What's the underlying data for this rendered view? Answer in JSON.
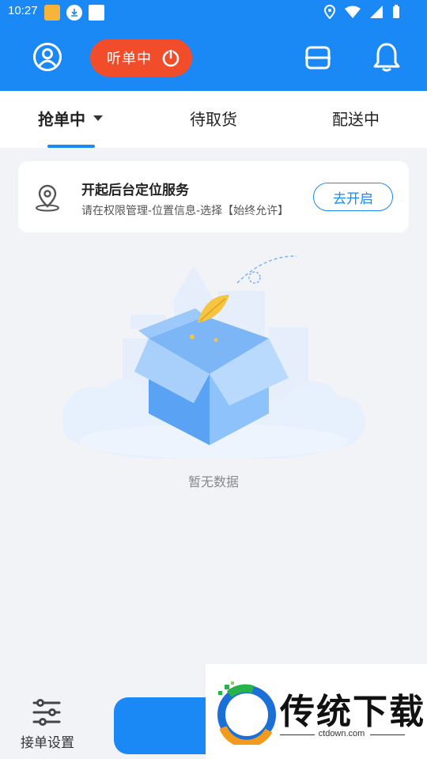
{
  "status_bar": {
    "time": "10:27"
  },
  "header": {
    "listen_label": "听单中",
    "colors": {
      "bar": "#1a88f5",
      "listen_pill": "#f24d2b"
    }
  },
  "tabs": [
    {
      "label": "抢单中",
      "active": true
    },
    {
      "label": "待取货",
      "active": false
    },
    {
      "label": "配送中",
      "active": false
    }
  ],
  "location_card": {
    "title": "开起后台定位服务",
    "subtitle": "请在权限管理-位置信息-选择【始终允许】",
    "button": "去开启"
  },
  "empty_state": {
    "text": "暂无数据"
  },
  "bottom": {
    "settings_label": "接单设置"
  },
  "watermark": {
    "title": "传统下载",
    "domain": "ctdown.com"
  }
}
